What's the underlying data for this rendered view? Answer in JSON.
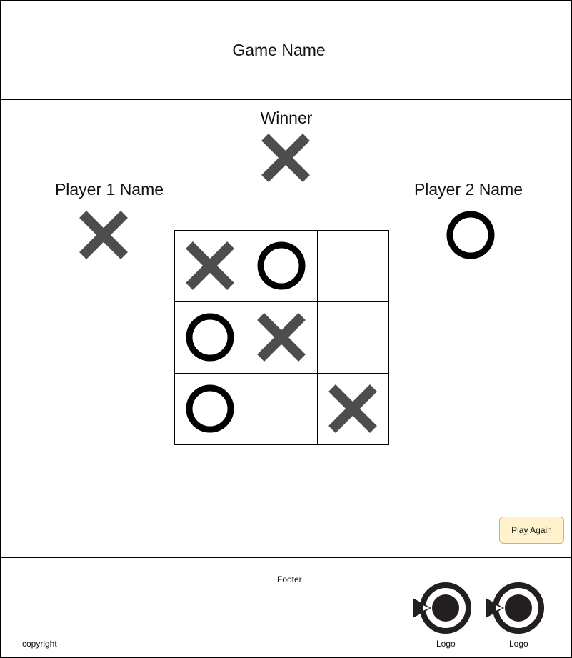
{
  "header": {
    "title": "Game Name"
  },
  "main": {
    "winner_label": "Winner",
    "winner_mark": "X",
    "player1": {
      "name": "Player 1 Name",
      "mark": "X"
    },
    "player2": {
      "name": "Player 2 Name",
      "mark": "O"
    },
    "board": [
      [
        "X",
        "O",
        ""
      ],
      [
        "O",
        "X",
        ""
      ],
      [
        "O",
        "",
        "X"
      ]
    ],
    "play_again_label": "Play Again"
  },
  "footer": {
    "label": "Footer",
    "copyright": "copyright",
    "logos": [
      {
        "label": "Logo",
        "icon": "logo-icon"
      },
      {
        "label": "Logo",
        "icon": "logo-icon"
      }
    ]
  },
  "colors": {
    "x_mark": "#4d4d4d",
    "o_mark": "#000000",
    "button_bg": "#fff2cc",
    "button_border": "#d6b656",
    "logo": "#231f20"
  }
}
